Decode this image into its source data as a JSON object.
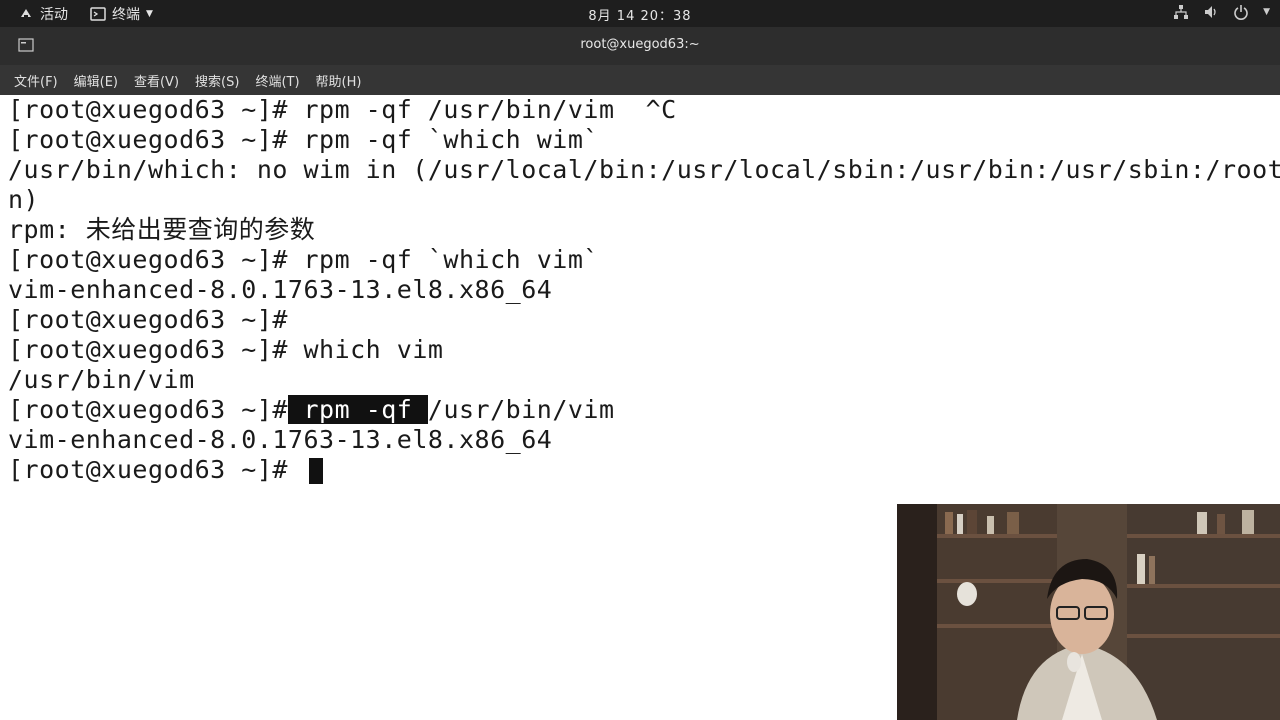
{
  "topbar": {
    "activities": "活动",
    "terminal_menu": "终端",
    "clock": "8月 14 20：38",
    "tray_icons": [
      "network-icon",
      "volume-icon",
      "power-icon"
    ]
  },
  "window": {
    "title": "root@xuegod63:~"
  },
  "menubar": {
    "items": [
      "文件(F)",
      "编辑(E)",
      "查看(V)",
      "搜索(S)",
      "终端(T)",
      "帮助(H)"
    ]
  },
  "terminal": {
    "lines": [
      "[root@xuegod63 ~]# rpm -qf /usr/bin/vim  ^C",
      "[root@xuegod63 ~]# rpm -qf `which wim`",
      "/usr/bin/which: no wim in (/usr/local/bin:/usr/local/sbin:/usr/bin:/usr/sbin:/root/bi",
      "n)",
      "rpm: 未给出要查询的参数",
      "[root@xuegod63 ~]# rpm -qf `which vim`",
      "vim-enhanced-8.0.1763-13.el8.x86_64",
      "[root@xuegod63 ~]#",
      "[root@xuegod63 ~]# which vim",
      "/usr/bin/vim"
    ],
    "sel_prompt": "[root@xuegod63 ~]#",
    "sel_text": " rpm -qf ",
    "sel_rest": "/usr/bin/vim",
    "after_sel": "vim-enhanced-8.0.1763-13.el8.x86_64",
    "last_prompt": "[root@xuegod63 ~]# "
  },
  "colors": {
    "topbar": "#1e1e1e",
    "titlebar": "#2d2d2d",
    "menubar": "#353535",
    "terminal_bg": "#ffffff",
    "terminal_fg": "#1a1a1a"
  }
}
